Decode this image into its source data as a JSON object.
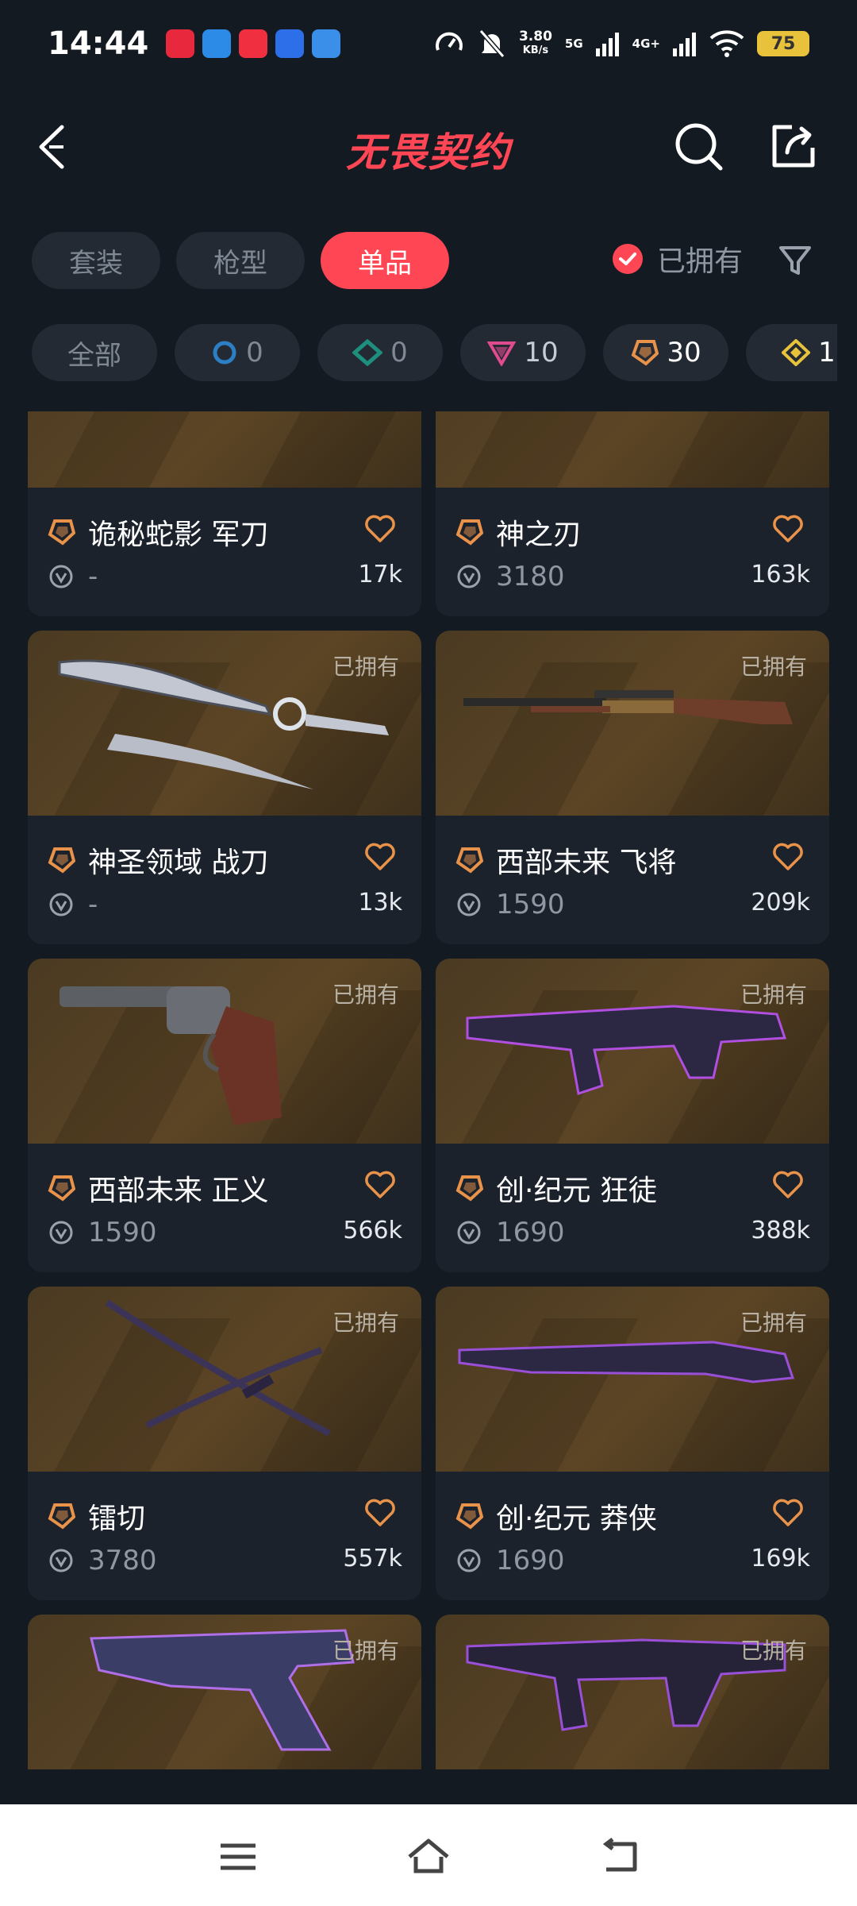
{
  "status_bar": {
    "time": "14:44",
    "speed_value": "3.80",
    "speed_unit": "KB/s",
    "net1": "5G",
    "net2": "4G+",
    "battery": "75"
  },
  "header": {
    "title": "无畏契约",
    "title_color": "#ff4655"
  },
  "tabs": [
    {
      "label": "套装",
      "active": false
    },
    {
      "label": "枪型",
      "active": false
    },
    {
      "label": "单品",
      "active": true
    }
  ],
  "owned_filter": {
    "label": "已拥有",
    "checked": true
  },
  "tier_chips": [
    {
      "label": "全部",
      "count": "",
      "icon": "all"
    },
    {
      "label": "",
      "count": "0",
      "icon": "tier-select-icon"
    },
    {
      "label": "",
      "count": "0",
      "icon": "tier-deluxe-icon"
    },
    {
      "label": "",
      "count": "10",
      "icon": "tier-premium-icon"
    },
    {
      "label": "",
      "count": "30",
      "icon": "tier-exclusive-icon"
    },
    {
      "label": "",
      "count": "1",
      "icon": "tier-ultra-icon"
    }
  ],
  "items": [
    {
      "name": "诡秘蛇影 军刀",
      "price": "-",
      "likes": "17k",
      "owned": "",
      "weapon": "knife-curved"
    },
    {
      "name": "神之刃",
      "price": "3180",
      "likes": "163k",
      "owned": "",
      "weapon": "knife-blade"
    },
    {
      "name": "神圣领域 战刀",
      "price": "-",
      "likes": "13k",
      "owned": "已拥有",
      "weapon": "knife-sword"
    },
    {
      "name": "西部未来 飞将",
      "price": "1590",
      "likes": "209k",
      "owned": "已拥有",
      "weapon": "rifle-lever"
    },
    {
      "name": "西部未来 正义",
      "price": "1590",
      "likes": "566k",
      "owned": "已拥有",
      "weapon": "revolver"
    },
    {
      "name": "创·纪元 狂徒",
      "price": "1690",
      "likes": "388k",
      "owned": "已拥有",
      "weapon": "rifle-assault"
    },
    {
      "name": "镭切",
      "price": "3780",
      "likes": "557k",
      "owned": "已拥有",
      "weapon": "katana"
    },
    {
      "name": "创·纪元 莽侠",
      "price": "1690",
      "likes": "169k",
      "owned": "已拥有",
      "weapon": "shotgun"
    },
    {
      "name": "",
      "price": "",
      "likes": "",
      "owned": "已拥有",
      "weapon": "pistol"
    },
    {
      "name": "",
      "price": "",
      "likes": "",
      "owned": "已拥有",
      "weapon": "smg"
    }
  ],
  "colors": {
    "accent": "#ff4655",
    "tier_orange": "#e8924a",
    "tier_pink": "#e04a8f",
    "tier_yellow": "#e8c23a",
    "tier_blue": "#2c7fc4",
    "tier_teal": "#1e8f7c"
  }
}
